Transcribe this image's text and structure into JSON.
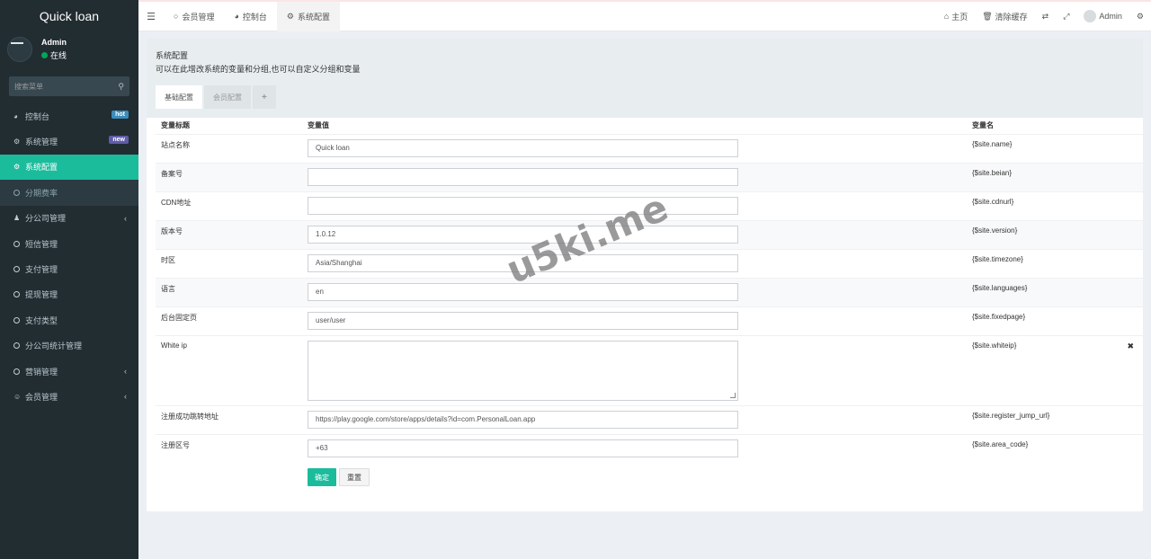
{
  "brand": "Quick loan",
  "user": {
    "name": "Admin",
    "status": "在线"
  },
  "search": {
    "placeholder": "搜索菜单"
  },
  "sidebar": {
    "items": [
      {
        "label": "控制台",
        "icon": "dashboard-icon",
        "badge": "hot",
        "badge_color": "#3c8dbc"
      },
      {
        "label": "系统管理",
        "icon": "cogs-icon",
        "badge": "new",
        "badge_color": "#605ca8"
      },
      {
        "label": "系统配置",
        "icon": "gear-icon",
        "active": true
      },
      {
        "label": "分期费率",
        "icon": "circle-icon",
        "sub": true
      },
      {
        "label": "分公司管理",
        "icon": "users-icon",
        "caret": "‹"
      },
      {
        "label": "短信管理",
        "icon": "circle-icon"
      },
      {
        "label": "支付管理",
        "icon": "circle-icon"
      },
      {
        "label": "提现管理",
        "icon": "circle-icon"
      },
      {
        "label": "支付类型",
        "icon": "circle-icon"
      },
      {
        "label": "分公司统计管理",
        "icon": "circle-icon"
      },
      {
        "label": "营销管理",
        "icon": "circle-icon",
        "caret": "‹"
      },
      {
        "label": "会员管理",
        "icon": "user-circle-icon",
        "caret": "‹"
      }
    ]
  },
  "header": {
    "tabs": [
      {
        "label": "会员管理",
        "icon": "circle-icon"
      },
      {
        "label": "控制台",
        "icon": "dashboard-icon"
      },
      {
        "label": "系统配置",
        "icon": "gear-icon",
        "active": true
      }
    ],
    "right": {
      "home": "主页",
      "clear_cache": "清除缓存",
      "user": "Admin"
    }
  },
  "panel": {
    "title": "系统配置",
    "desc": "可以在此增改系统的变量和分组,也可以自定义分组和变量",
    "tabs": [
      "基础配置",
      "会员配置",
      "+"
    ]
  },
  "table": {
    "headers": [
      "变量标题",
      "变量值",
      "变量名"
    ],
    "rows": [
      {
        "title": "站点名称",
        "value": "Quick loan",
        "name": "{$site.name}"
      },
      {
        "title": "备案号",
        "value": "",
        "name": "{$site.beian}"
      },
      {
        "title": "CDN地址",
        "value": "",
        "name": "{$site.cdnurl}"
      },
      {
        "title": "版本号",
        "value": "1.0.12",
        "name": "{$site.version}"
      },
      {
        "title": "时区",
        "value": "Asia/Shanghai",
        "name": "{$site.timezone}"
      },
      {
        "title": "语言",
        "value": "en",
        "name": "{$site.languages}"
      },
      {
        "title": "后台固定页",
        "value": "user/user",
        "name": "{$site.fixedpage}"
      },
      {
        "title": "White ip",
        "value": "",
        "name": "{$site.whiteip}",
        "textarea": true,
        "delete": "✖"
      },
      {
        "title": "注册成功跳转地址",
        "value": "https://play.google.com/store/apps/details?id=com.PersonalLoan.app",
        "name": "{$site.register_jump_url}"
      },
      {
        "title": "注册区号",
        "value": "+63",
        "name": "{$site.area_code}"
      }
    ]
  },
  "buttons": {
    "submit": "确定",
    "reset": "重置"
  },
  "watermark": "u5ki.me"
}
